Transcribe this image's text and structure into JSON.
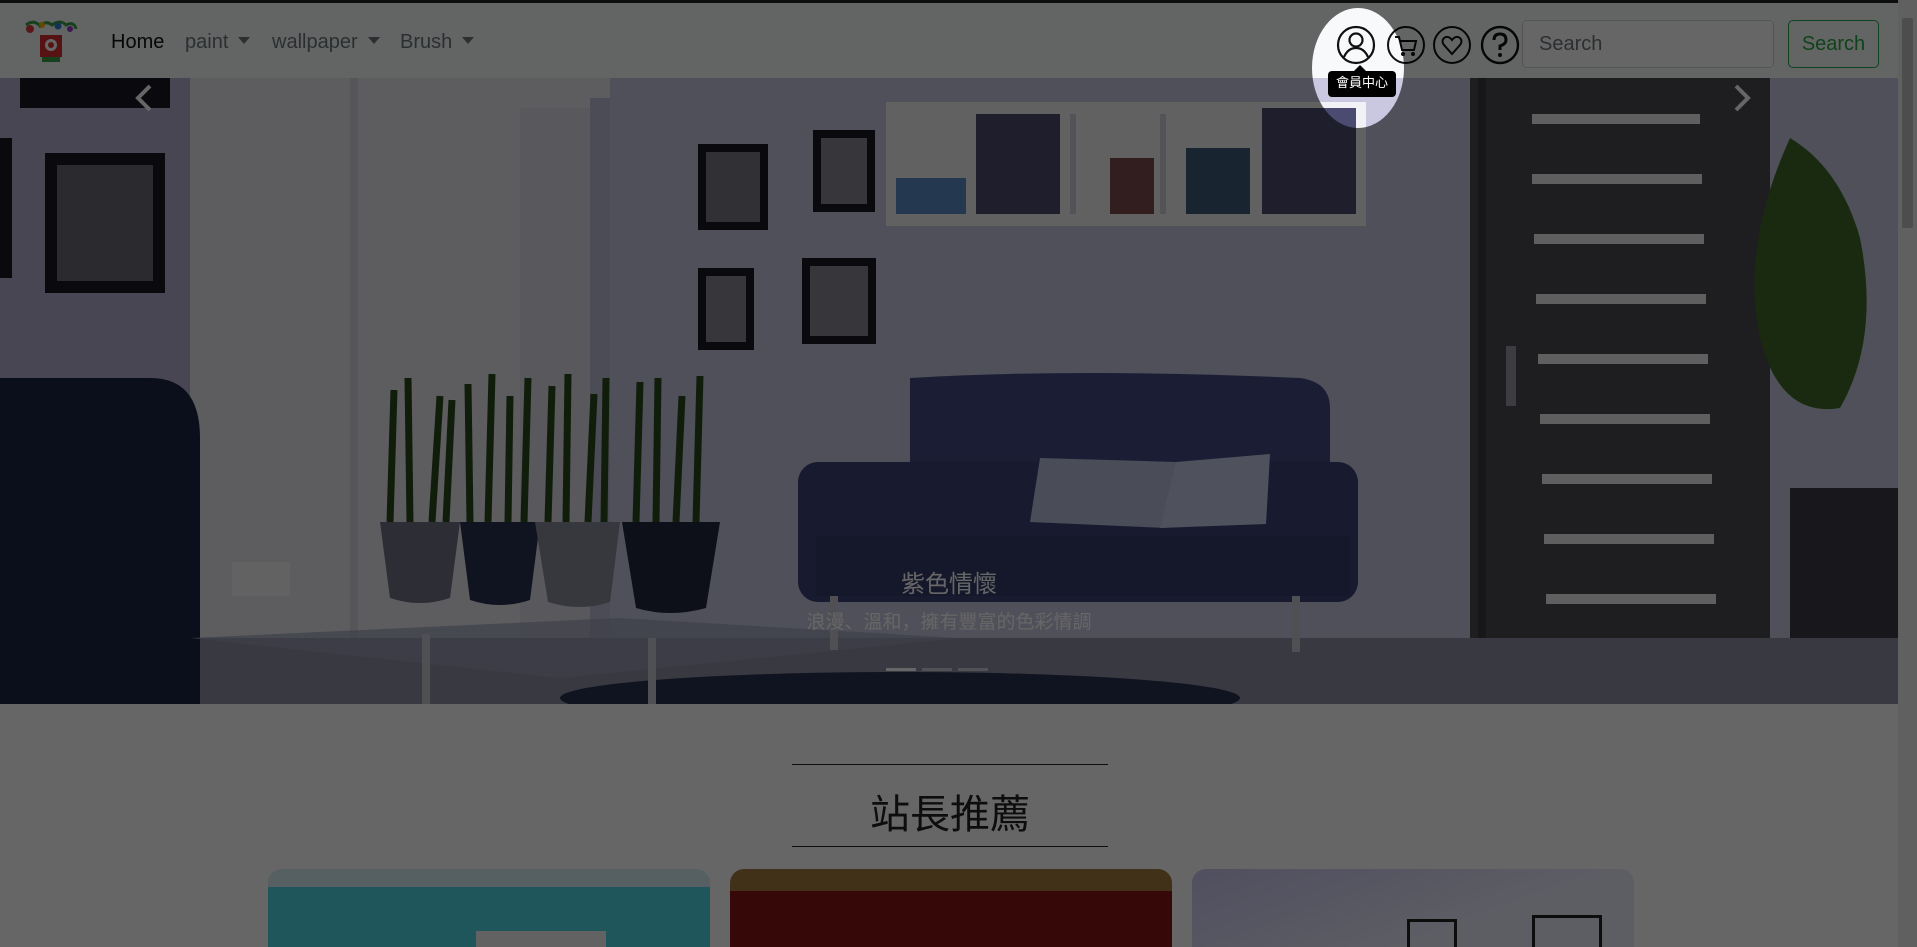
{
  "navbar": {
    "items": [
      {
        "label": "Home",
        "active": true,
        "dropdown": false
      },
      {
        "label": "paint",
        "active": false,
        "dropdown": true
      },
      {
        "label": "wallpaper",
        "active": false,
        "dropdown": true
      },
      {
        "label": "Brush",
        "active": false,
        "dropdown": true
      }
    ],
    "icons": [
      "user-icon",
      "cart-icon",
      "heart-icon",
      "help-icon"
    ],
    "search": {
      "placeholder": "Search",
      "button_label": "Search"
    }
  },
  "tooltip": {
    "text": "會員中心"
  },
  "carousel": {
    "caption_title": "紫色情懷",
    "caption_text": "浪漫、溫和，擁有豐富的色彩情調",
    "slide_count": 3,
    "active_slide": 0
  },
  "recommend": {
    "title": "站長推薦"
  },
  "colors": {
    "accent_green": "#28a745",
    "overlay": "rgba(0,0,0,0.6)",
    "room_wall": "#c9c8e0"
  }
}
